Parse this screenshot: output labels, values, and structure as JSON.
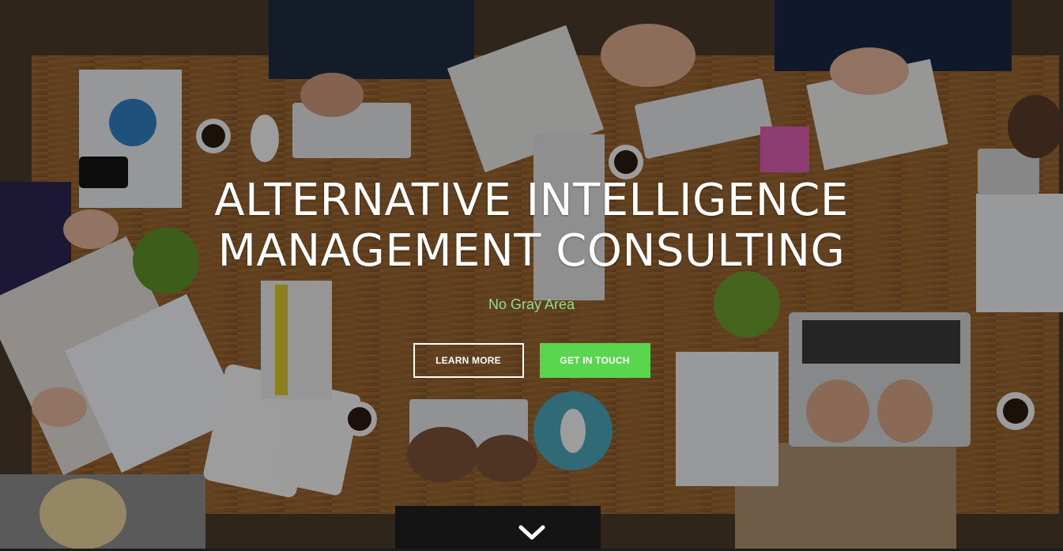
{
  "hero": {
    "headline_line1": "ALTERNATIVE INTELLIGENCE",
    "headline_line2": "MANAGEMENT CONSULTING",
    "tagline": "No Gray Area",
    "learn_more_label": "LEARN MORE",
    "get_in_touch_label": "GET IN TOUCH",
    "scroll_icon": "chevron-down-icon"
  },
  "colors": {
    "accent_green": "#5ad54e",
    "tagline_green": "#8ee08a",
    "text_white": "#ffffff"
  }
}
